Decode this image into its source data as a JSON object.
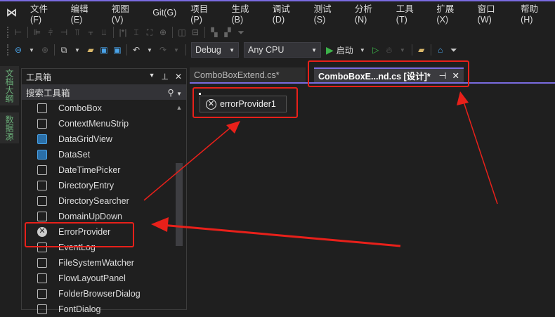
{
  "menu": [
    "文件(F)",
    "编辑(E)",
    "视图(V)",
    "Git(G)",
    "项目(P)",
    "生成(B)",
    "调试(D)",
    "测试(S)",
    "分析(N)",
    "工具(T)",
    "扩展(X)",
    "窗口(W)",
    "帮助(H)"
  ],
  "toolbar": {
    "config": "Debug",
    "platform": "Any CPU",
    "start": "启动"
  },
  "side_tabs": [
    "文档大纲",
    "数据源"
  ],
  "toolbox": {
    "title": "工具箱",
    "search_placeholder": "搜索工具箱",
    "items": [
      "ComboBox",
      "ContextMenuStrip",
      "DataGridView",
      "DataSet",
      "DateTimePicker",
      "DirectoryEntry",
      "DirectorySearcher",
      "DomainUpDown",
      "ErrorProvider",
      "EventLog",
      "FileSystemWatcher",
      "FlowLayoutPanel",
      "FolderBrowserDialog",
      "FontDialog"
    ]
  },
  "tabs": {
    "tab1": "ComboBoxExtend.cs*",
    "tab2": "ComboBoxE...nd.cs [设计]*"
  },
  "designer": {
    "component": "errorProvider1"
  },
  "colors": {
    "accent": "#7a6be0",
    "highlight": "#e8201a"
  }
}
